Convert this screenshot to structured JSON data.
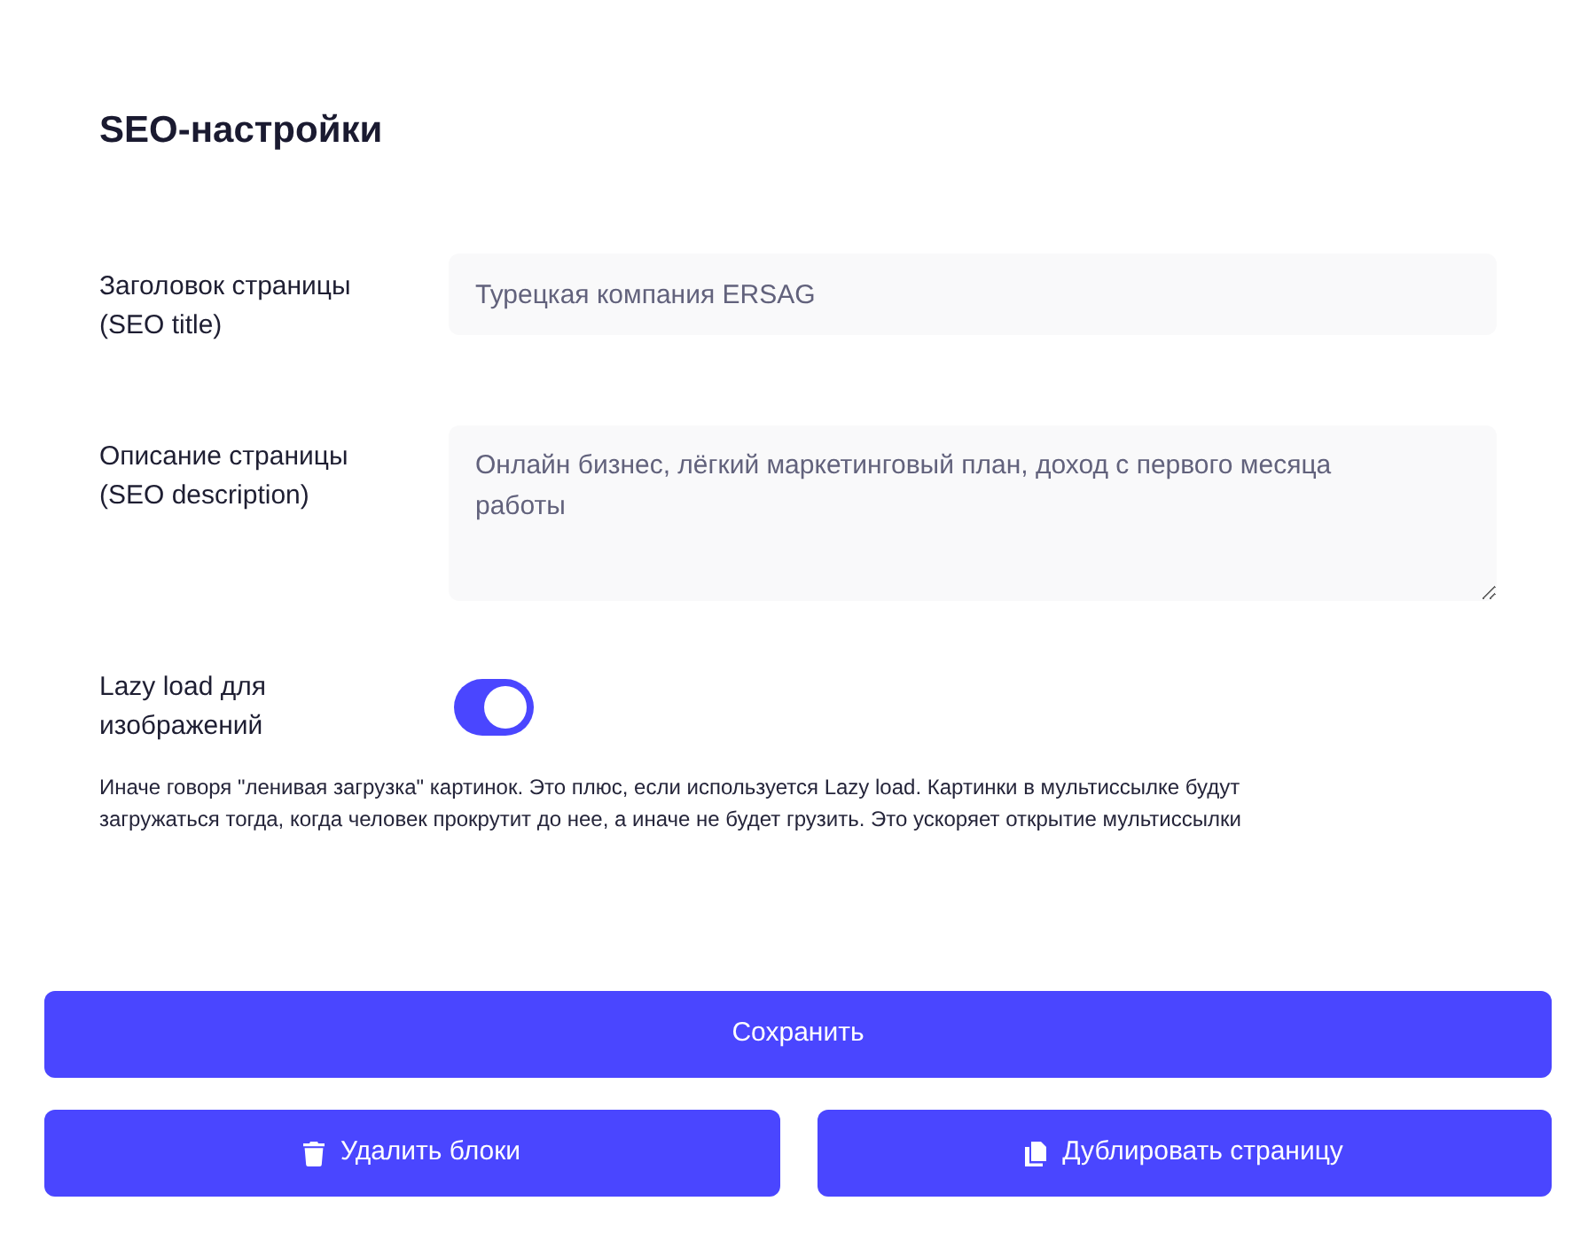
{
  "section": {
    "title": "SEO-настройки"
  },
  "fields": [
    {
      "kind": "input",
      "label": "Заголовок страницы (SEO title)",
      "value": "Турецкая компания ERSAG"
    },
    {
      "kind": "textarea",
      "label": "Описание страницы (SEO description)",
      "value": "Онлайн бизнес, лёгкий маркетинговый план, доход с первого месяца работы"
    }
  ],
  "toggle": {
    "label": "Lazy load для изображений",
    "on": true,
    "hint": "Иначе говоря \"ленивая загрузка\" картинок. Это плюс, если используется Lazy load. Картинки в мультиссылке будут загружаться тогда, когда человек прокрутит до нее, а иначе не будет грузить. Это ускоряет открытие мультиссылки"
  },
  "save_button": {
    "label": "Сохранить"
  },
  "actions": [
    {
      "kind": "delete",
      "label": "Удалить блоки"
    },
    {
      "kind": "duplicate",
      "label": "Дублировать страницу"
    }
  ]
}
